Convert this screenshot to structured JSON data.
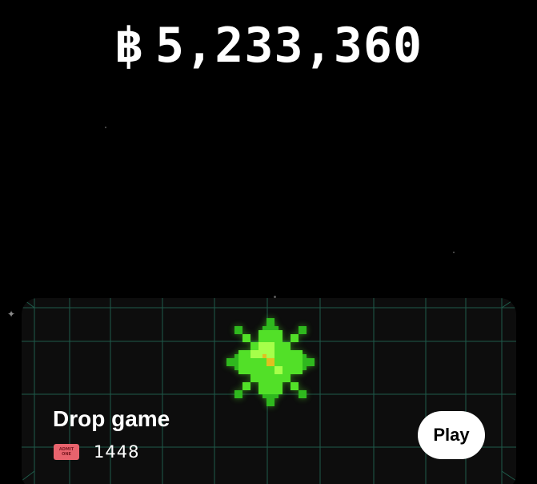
{
  "balance": {
    "currency_symbol": "฿",
    "amount": "5,233,360"
  },
  "game_card": {
    "title": "Drop game",
    "ticket_icon": "admit-one-ticket-icon",
    "ticket_text": [
      "ADMIT",
      "ONE"
    ],
    "ticket_count": "1448",
    "play_label": "Play",
    "star_icon": "pixel-star-icon"
  },
  "colors": {
    "background": "#000000",
    "card_background": "#0d0d0d",
    "grid_line": "#1f5a4a",
    "star_dark": "#2fb81e",
    "star_mid": "#52e028",
    "star_light": "#a6ff4a",
    "star_core": "#e0c020",
    "ticket": "#e8636d",
    "button": "#ffffff"
  }
}
